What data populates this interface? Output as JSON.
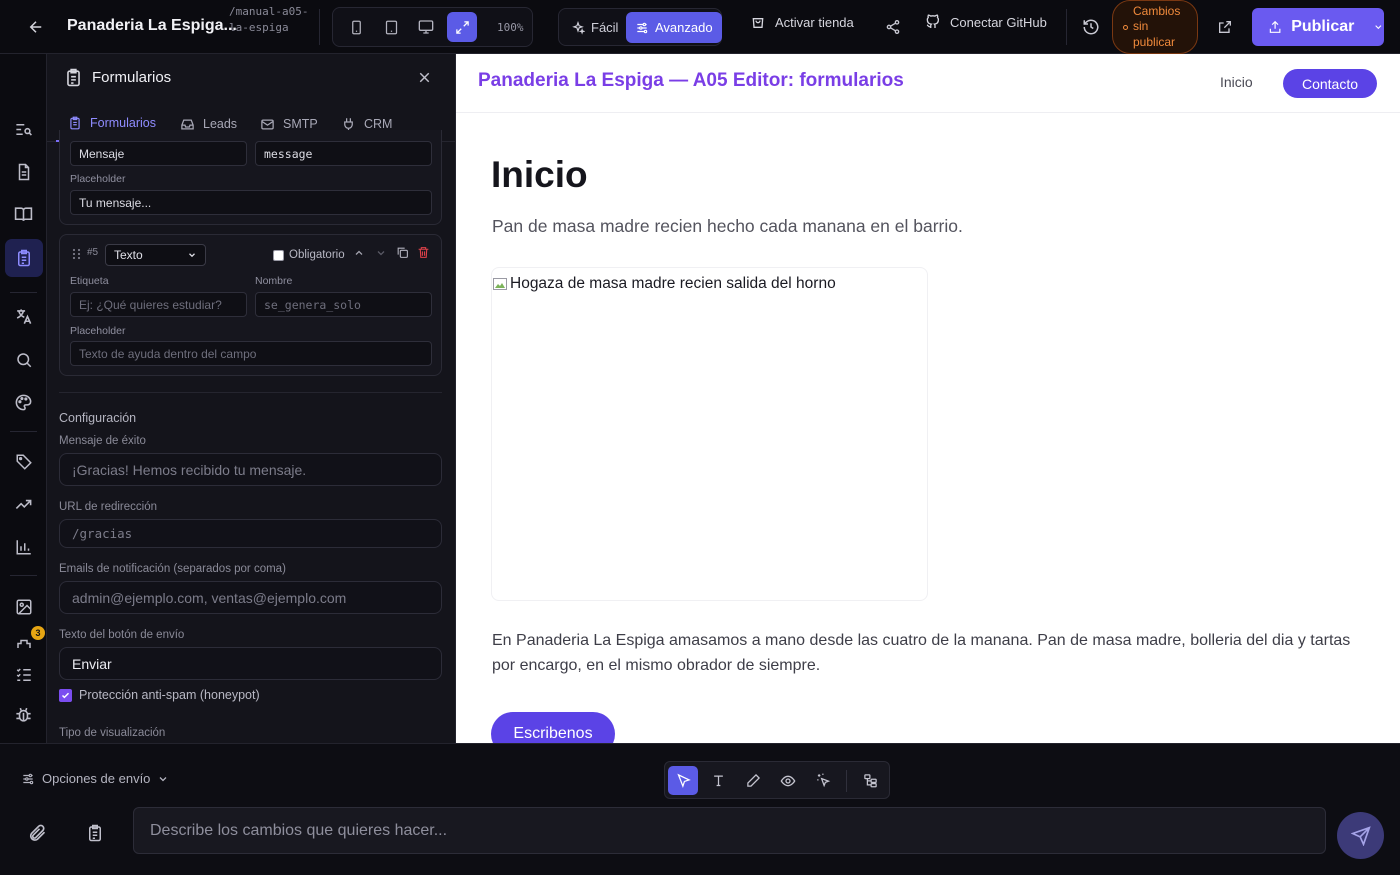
{
  "topbar": {
    "project_title": "Panaderia La Espiga...",
    "project_slug": "/manual-a05-la-espiga",
    "zoom": "100%",
    "mode_easy": "Fácil",
    "mode_advanced": "Avanzado",
    "activate_store": "Activar tienda",
    "connect_github": "Conectar GitHub",
    "unpublished_changes": "Cambios sin publicar",
    "publish": "Publicar"
  },
  "rail": {
    "items": [
      "search-list-icon",
      "page-icon",
      "book-icon",
      "forms-icon",
      "translate-icon",
      "search-icon",
      "palette-icon",
      "tag-icon",
      "trend-icon",
      "chart-icon",
      "image-icon",
      "plugin-icon",
      "checklist-icon",
      "bug-icon"
    ],
    "badge_count": "3"
  },
  "panel": {
    "title": "Formularios",
    "tabs": [
      {
        "label": "Formularios"
      },
      {
        "label": "Leads"
      },
      {
        "label": "SMTP"
      },
      {
        "label": "CRM"
      }
    ],
    "field4": {
      "label_value": "Mensaje",
      "name_value": "message",
      "placeholder_label": "Placeholder",
      "placeholder_value": "Tu mensaje..."
    },
    "field5": {
      "number": "#5",
      "type": "Texto",
      "required_label": "Obligatorio",
      "label_label": "Etiqueta",
      "label_placeholder": "Ej: ¿Qué quieres estudiar?",
      "name_label": "Nombre",
      "name_placeholder": "se_genera_solo",
      "placeholder_label": "Placeholder",
      "placeholder_placeholder": "Texto de ayuda dentro del campo"
    },
    "config": {
      "title": "Configuración",
      "success_label": "Mensaje de éxito",
      "success_placeholder": "¡Gracias! Hemos recibido tu mensaje.",
      "redirect_label": "URL de redirección",
      "redirect_placeholder": "/gracias",
      "emails_label": "Emails de notificación (separados por coma)",
      "emails_placeholder": "admin@ejemplo.com, ventas@ejemplo.com",
      "submit_label": "Texto del botón de envío",
      "submit_value": "Enviar",
      "honeypot_label": "Protección anti-spam (honeypot)",
      "display_type_label": "Tipo de visualización"
    }
  },
  "preview": {
    "site_title": "Panaderia La Espiga — A05 Editor: formularios",
    "nav_home": "Inicio",
    "nav_contact": "Contacto",
    "heading": "Inicio",
    "lead": "Pan de masa madre recien hecho cada manana en el barrio.",
    "image_alt": "Hogaza de masa madre recien salida del horno",
    "body": "En Panaderia La Espiga amasamos a mano desde las cuatro de la manana. Pan de masa madre, bolleria del dia y tartas por encargo, en el mismo obrador de siempre.",
    "cta": "Escribenos"
  },
  "bottom": {
    "send_options": "Opciones de envío",
    "prompt_placeholder": "Describe los cambios que quieres hacer..."
  },
  "colors": {
    "accent": "#5b5be6",
    "publish": "#6a5af0",
    "site_title": "#7a3ee6",
    "site_button": "#5b43e6",
    "unpublished": "#f08a3c"
  }
}
